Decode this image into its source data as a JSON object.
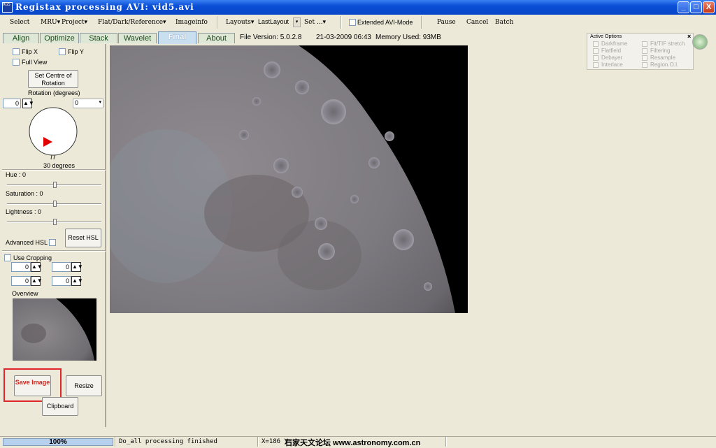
{
  "window": {
    "title": "Registax processing AVI: vid5.avi",
    "icon_text": "RGS",
    "controls": [
      "_",
      "□",
      "X"
    ]
  },
  "menu": {
    "select": "Select",
    "mru": "MRU▾",
    "project": "Project▾",
    "flat_dark_reference": "Flat/Dark/Reference▾",
    "imageinfo": "Imageinfo",
    "layouts": "Layouts▾",
    "layout_value": "LastLayout",
    "set": "Set ...▾",
    "extended_avi_mode": "Extended AVI-Mode",
    "pause": "Pause",
    "cancel": "Cancel",
    "batch": "Batch"
  },
  "tabs": [
    {
      "label": "Align",
      "active": false
    },
    {
      "label": "Optimize",
      "active": false
    },
    {
      "label": "Stack",
      "active": false
    },
    {
      "label": "Wavelet",
      "active": false
    },
    {
      "label": "Final",
      "active": true
    },
    {
      "label": "About",
      "active": false
    }
  ],
  "info": {
    "file_version": "File Version: 5.0.2.8",
    "date": "21-03-2009 06:43",
    "memory": "Memory Used: 93MB"
  },
  "left_panel": {
    "flip_x": "Flip X",
    "flip_y": "Flip Y",
    "full_view": "Full View",
    "set_centre": "Set Centre of Rotation",
    "rotation_label": "Rotation (degrees)",
    "rotation_value": "0",
    "rotation_dropdown": "0",
    "dial_label": "30 degrees",
    "hue": "Hue : 0",
    "saturation": "Saturation : 0",
    "lightness": "Lightness : 0",
    "advanced_hsl": "Advanced HSL",
    "reset_hsl": "Reset HSL",
    "use_cropping": "Use Cropping",
    "crop": [
      "0",
      "0",
      "0",
      "0"
    ],
    "overview": "Overview",
    "save_image": "Save Image",
    "resize": "Resize",
    "clipboard": "Clipboard"
  },
  "active_options": {
    "title": "Active Options",
    "items": [
      "Darkframe",
      "Fit/TIF stretch",
      "Flatfield",
      "Filtering",
      "Debayer",
      "Resample",
      "Interlace",
      "Region.O.I."
    ]
  },
  "status": {
    "progress": "100%",
    "message": "Do_all processing finished",
    "coords": "X=186 Y=...",
    "watermark": "石家天文论坛 www.astronomy.com.cn"
  },
  "colors": {
    "title_blue": "#0a4fd6",
    "active_tab": "#c9dff0",
    "highlight_red": "#e0262a",
    "dial_pointer": "#e00000"
  }
}
